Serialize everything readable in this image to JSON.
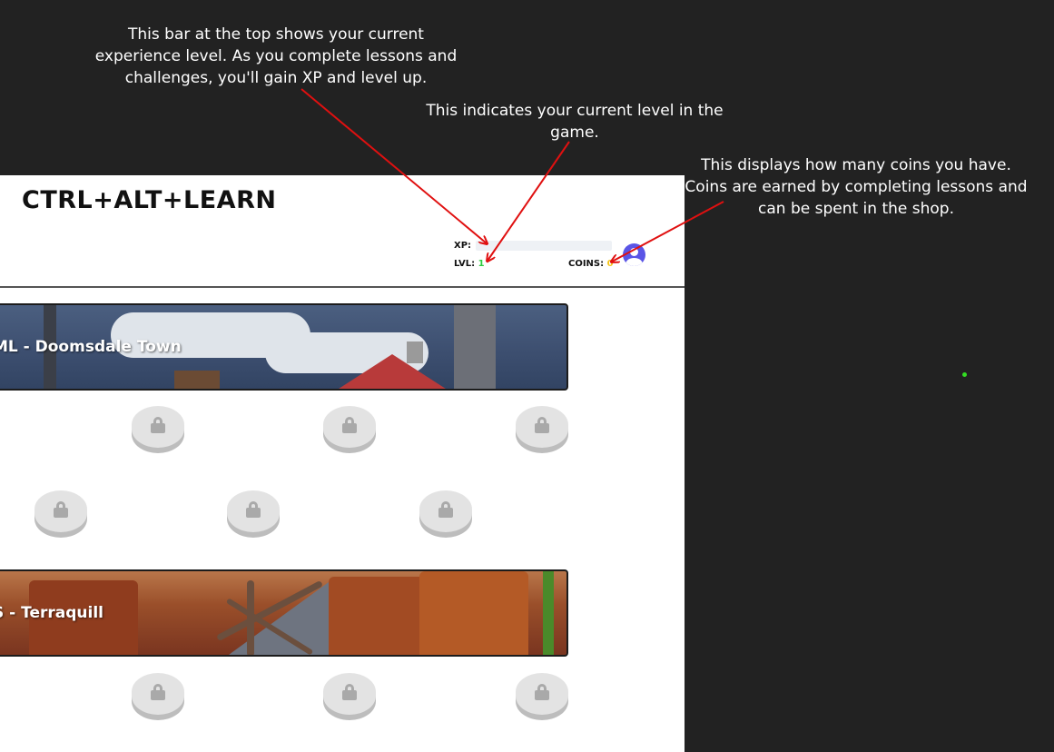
{
  "annotations": {
    "xp_note": "This bar at the top shows your current experience level.  As you complete lessons and challenges, you'll gain XP and level up.",
    "level_note": "This indicates your current level in the game.",
    "coins_note": "This displays how many coins you have. Coins are earned by completing lessons and can be spent in the shop."
  },
  "header": {
    "brand": "CTRL+ALT+LEARN",
    "xp_label": "XP:",
    "xp_progress": 0,
    "level_label": "LVL:",
    "level_value": "1",
    "coins_label": "COINS:",
    "coins_value": "0",
    "avatar_icon": "user-avatar-icon"
  },
  "worlds": [
    {
      "title": "ML - Doomsdale Town",
      "lessons_locked": 6
    },
    {
      "title": "S - Terraquill",
      "lessons_locked": 3
    }
  ],
  "colors": {
    "background": "#222222",
    "annotation_arrow": "#e01010",
    "level_value": "#2ecc40",
    "coins_value": "#f5c518",
    "avatar": "#5a55e6",
    "locked_button": "#e3e3e3"
  },
  "icons": {
    "lesson": "lock-icon"
  }
}
